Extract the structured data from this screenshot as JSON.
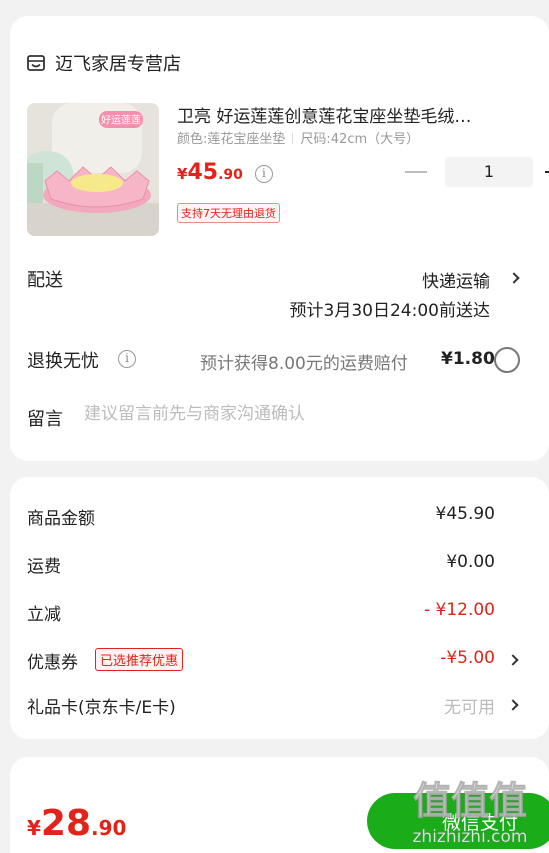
{
  "store": {
    "name": "迈飞家居专营店"
  },
  "product": {
    "title": "卫亮 好运莲莲创意莲花宝座坐垫毛绒…",
    "spec_color": "颜色:莲花宝座坐垫",
    "spec_size": "尺码:42cm（大号）",
    "image_badge": "好运莲莲",
    "price_currency": "¥",
    "price_integer": "45",
    "price_decimal": ".90",
    "info_icon": "i",
    "quantity": "1",
    "return_tag": "支持7天无理由退货"
  },
  "shipping": {
    "label": "配送",
    "method": "快递运输",
    "eta": "预计3月30日24:00前送达"
  },
  "returns": {
    "label": "退换无忧",
    "info_icon": "i",
    "description": "预计获得8.00元的运费赔付",
    "price": "¥1.80"
  },
  "note": {
    "label": "留言",
    "placeholder": "建议留言前先与商家沟通确认"
  },
  "summary": {
    "goods_label": "商品金额",
    "goods_value": "¥45.90",
    "freight_label": "运费",
    "freight_value": "¥0.00",
    "discount_label": "立减",
    "discount_value": "- ¥12.00",
    "coupon_label": "优惠券",
    "coupon_tag": "已选推荐优惠",
    "coupon_value": "-¥5.00",
    "giftcard_label": "礼品卡(京东卡/E卡)",
    "giftcard_value": "无可用"
  },
  "checkout": {
    "total_currency": "¥",
    "total_integer": "28",
    "total_decimal": ".90",
    "pay_button": "微信支付"
  },
  "watermark": {
    "logo_text": "值值值",
    "site": "zhizhizhi.com"
  },
  "colors": {
    "accent_red": "#e2231a",
    "pay_green": "#1aad19",
    "background": "#f2f2f2"
  }
}
